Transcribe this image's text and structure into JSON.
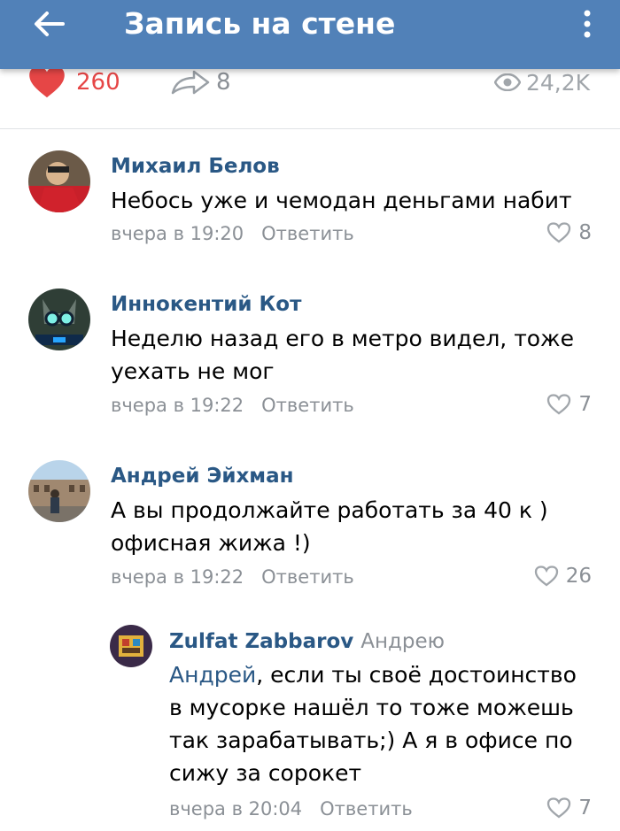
{
  "header": {
    "title": "Запись на стене",
    "back_icon": "arrow-left-icon",
    "menu_icon": "more-vertical-icon"
  },
  "stats": {
    "likes": "260",
    "shares": "8",
    "views": "24,2K",
    "like_color": "#e64646"
  },
  "comments": [
    {
      "author": "Михаил Белов",
      "text": "Небось уже и чемодан деньгами набит",
      "time": "вчера в 19:20",
      "reply_label": "Ответить",
      "likes": "8"
    },
    {
      "author": "Иннокентий Кот",
      "text": "Неделю назад его в метро видел, тоже уехать не мог",
      "time": "вчера в 19:22",
      "reply_label": "Ответить",
      "likes": "7"
    },
    {
      "author": "Андрей Эйхман",
      "text": "А вы продолжайте работать за 40 к ) офисная жижа !)",
      "time": "вчера в 19:22",
      "reply_label": "Ответить",
      "likes": "26"
    },
    {
      "author": "Zulfat Zabbarov",
      "reply_to": "Андрею",
      "mention": "Андрей",
      "text": ", если ты своё достоинство в мусорке нашёл то тоже можешь так зарабатывать;) А я в офисе по сижу за сорокет",
      "time": "вчера в 20:04",
      "reply_label": "Ответить",
      "likes": "7"
    }
  ],
  "colors": {
    "header_bg": "#5181b8",
    "author_link": "#2a5885",
    "meta_gray": "#8b9096"
  }
}
